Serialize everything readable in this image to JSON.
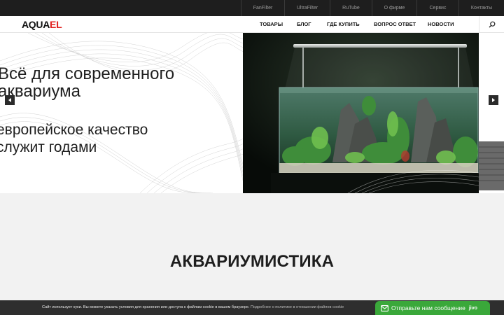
{
  "topbar": {
    "links": [
      {
        "label": "FanFilter"
      },
      {
        "label": "UltraFilter"
      },
      {
        "label": "RuTube"
      },
      {
        "label": "О фирме"
      },
      {
        "label": "Сервис"
      },
      {
        "label": "Контакты"
      }
    ]
  },
  "header": {
    "logo_part1": "AQUA",
    "logo_part2": "EL",
    "nav": [
      {
        "label": "ТОВАРЫ"
      },
      {
        "label": "БЛОГ"
      },
      {
        "label": "ГДЕ КУПИТЬ"
      },
      {
        "label": "ВОПРОС ОТВЕТ"
      },
      {
        "label": "НОВОСТИ"
      }
    ],
    "search_icon": "search-icon"
  },
  "hero": {
    "title_line1": "Всё для современного",
    "title_line2": "аквариума",
    "subtitle_line1": "европейское качество",
    "subtitle_line2": "служит годами",
    "prev_icon": "arrow-left-icon",
    "next_icon": "arrow-right-icon"
  },
  "section": {
    "title": "АКВАРИУМИСТИКА"
  },
  "cookie": {
    "text": "Сайт использует куки. Вы можете указать условия для хранения или доступа к файлам cookie в вашем браузере.",
    "link": "Подробнее о политике в отношении файлов cookie"
  },
  "chat": {
    "label": "Отправьте нам сообщение",
    "brand": "jivo",
    "icon": "envelope-icon"
  },
  "colors": {
    "brand_red": "#e1211f",
    "chat_green": "#3aa83a",
    "topbar": "#1e1e1e"
  }
}
